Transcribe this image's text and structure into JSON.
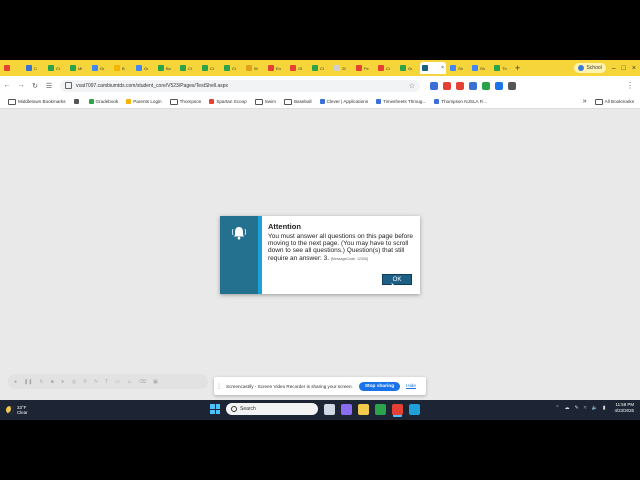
{
  "browser": {
    "tabs": [
      {
        "favicon_color": "#e44134",
        "title": ""
      },
      {
        "favicon_color": "#3a6fd8",
        "title": "C"
      },
      {
        "favicon_color": "#2aa34a",
        "title": "Cl"
      },
      {
        "favicon_color": "#2aa34a",
        "title": "Mi"
      },
      {
        "favicon_color": "#4285f4",
        "title": "Gr"
      },
      {
        "favicon_color": "#f4b400",
        "title": "B"
      },
      {
        "favicon_color": "#4285f4",
        "title": "Gr"
      },
      {
        "favicon_color": "#2aa34a",
        "title": "Bo"
      },
      {
        "favicon_color": "#2aa34a",
        "title": "Cl"
      },
      {
        "favicon_color": "#2aa34a",
        "title": "Cl"
      },
      {
        "favicon_color": "#2aa34a",
        "title": "Cl"
      },
      {
        "favicon_color": "#e0a11b",
        "title": "W"
      },
      {
        "favicon_color": "#e44134",
        "title": "En"
      },
      {
        "favicon_color": "#e44134",
        "title": "Of"
      },
      {
        "favicon_color": "#2aa34a",
        "title": "Cl"
      },
      {
        "favicon_color": "#d0d0d0",
        "title": "20"
      },
      {
        "favicon_color": "#e44134",
        "title": "Fe"
      },
      {
        "favicon_color": "#e44134",
        "title": "Cl"
      },
      {
        "favicon_color": "#2aa34a",
        "title": "Gr"
      },
      {
        "favicon_color": "#1e5f86",
        "title": "",
        "active": true
      },
      {
        "favicon_color": "#4285f4",
        "title": "Sh"
      },
      {
        "favicon_color": "#4285f4",
        "title": "Sh"
      },
      {
        "favicon_color": "#2aa34a",
        "title": "Th"
      }
    ],
    "profile_label": "School",
    "url": "vsat7097.cambiumtds.com/student_core/V523/Pages/TestShell.aspx",
    "extension_colors": [
      "#3a6fd8",
      "#e44134",
      "#e44134",
      "#3a6fd8",
      "#2aa34a",
      "#1a73e8",
      "#555555"
    ],
    "bookmarks": [
      {
        "label": "Middletown Bookmarks",
        "type": "folder"
      },
      {
        "label": "",
        "type": "apps"
      },
      {
        "label": "Gradebook",
        "type": "link",
        "color": "#2aa34a"
      },
      {
        "label": "Parents Login",
        "type": "link",
        "color": "#f4b400"
      },
      {
        "label": "Thompson",
        "type": "folder"
      },
      {
        "label": "Spartan Scoop",
        "type": "link",
        "color": "#e44134"
      },
      {
        "label": "Swim",
        "type": "folder"
      },
      {
        "label": "Baseball",
        "type": "folder"
      },
      {
        "label": "Clever | Applications",
        "type": "link",
        "color": "#3a6fd8"
      },
      {
        "label": "Timesheets Throug...",
        "type": "link",
        "color": "#3a6fd8"
      },
      {
        "label": "Thompson NJSLA Fi...",
        "type": "link",
        "color": "#3a6fd8"
      }
    ],
    "all_bookmarks_label": "All Bookmarks"
  },
  "dialog": {
    "title": "Attention",
    "message": "You must answer all questions on this page before moving to the next page. (You may have to scroll down to see all questions.) Question(s) that still require an answer: 3.",
    "message_code": "[MessageCode: 12306]",
    "ok_label": "OK",
    "icon": "bell-icon",
    "sidebar_color": "#24718f",
    "accent_color": "#1aa3d8"
  },
  "sharing": {
    "message": "Screencastify - Screen Video Recorder is sharing your screen.",
    "stop_label": "Stop sharing",
    "hide_label": "Hide"
  },
  "taskbar": {
    "weather_temp": "33°F",
    "weather_desc": "Clear",
    "search_placeholder": "Search",
    "time": "11:58 PM",
    "date": "4/23/2026",
    "apps": [
      {
        "name": "task-view",
        "color": "#cfd8e3"
      },
      {
        "name": "copilot",
        "color": "#8a6cf0"
      },
      {
        "name": "file-explorer",
        "color": "#f2c94c"
      },
      {
        "name": "google-drive",
        "color": "#2aa34a"
      },
      {
        "name": "chrome",
        "color": "#e44134",
        "active": true
      },
      {
        "name": "edge",
        "color": "#1fa0d8"
      }
    ]
  }
}
